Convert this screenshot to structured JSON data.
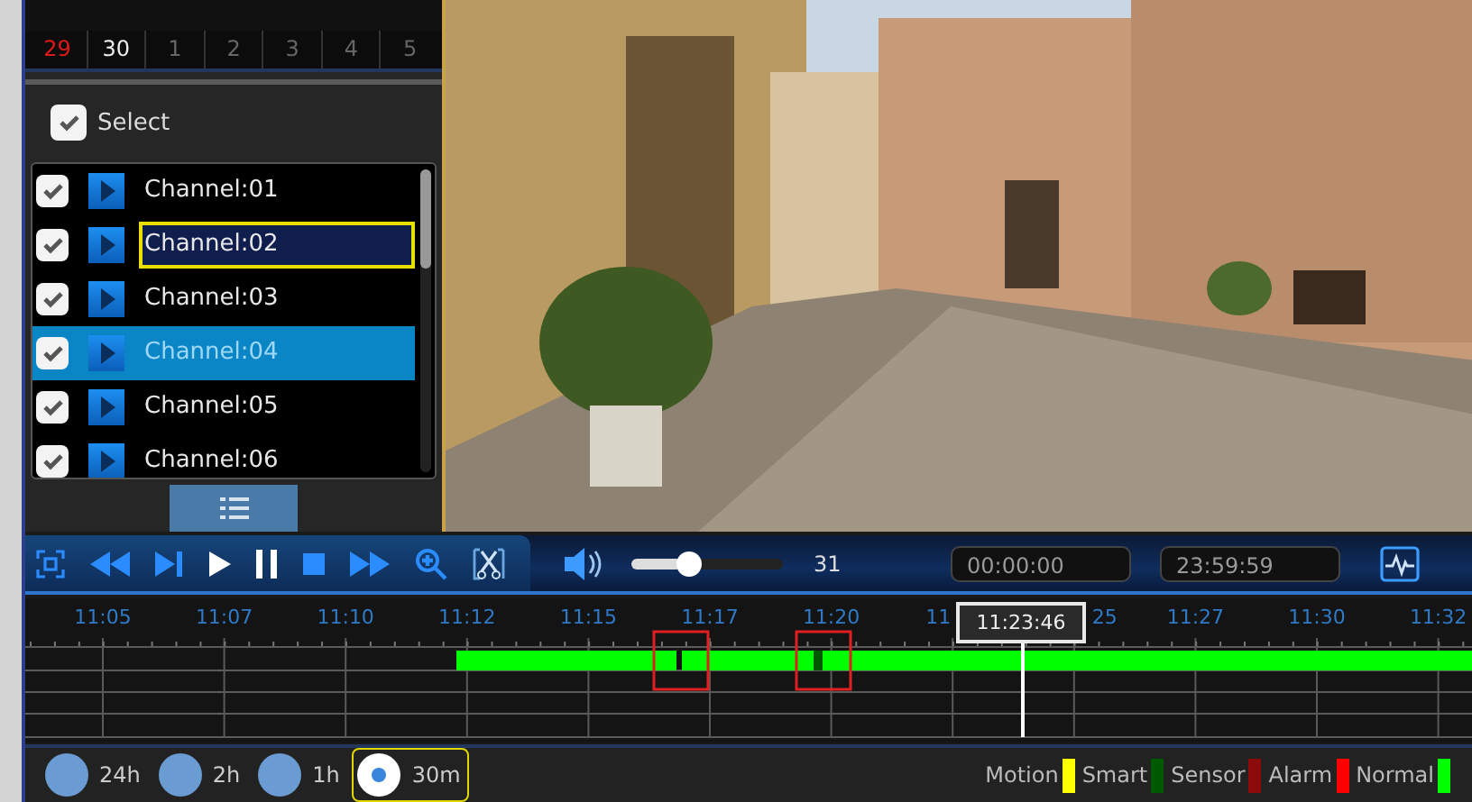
{
  "calendar": {
    "days": [
      {
        "text": "29",
        "kind": "weekend"
      },
      {
        "text": "30",
        "kind": "current"
      },
      {
        "text": "1",
        "kind": "other"
      },
      {
        "text": "2",
        "kind": "other"
      },
      {
        "text": "3",
        "kind": "other"
      },
      {
        "text": "4",
        "kind": "other"
      },
      {
        "text": "5",
        "kind": "other"
      }
    ]
  },
  "select_all": {
    "label": "Select",
    "checked": true
  },
  "channels": [
    {
      "name": "Channel:01",
      "checked": true,
      "selected": false,
      "focused": false
    },
    {
      "name": "Channel:02",
      "checked": true,
      "selected": false,
      "focused": true
    },
    {
      "name": "Channel:03",
      "checked": true,
      "selected": false,
      "focused": false
    },
    {
      "name": "Channel:04",
      "checked": true,
      "selected": true,
      "focused": false
    },
    {
      "name": "Channel:05",
      "checked": true,
      "selected": false,
      "focused": false
    },
    {
      "name": "Channel:06",
      "checked": true,
      "selected": false,
      "focused": false
    }
  ],
  "volume": {
    "level": 0.33,
    "reading": "31"
  },
  "start_time": "00:00:00",
  "end_time": "23:59:59",
  "timeline": {
    "labels": [
      {
        "text": "11:05"
      },
      {
        "text": "11:07"
      },
      {
        "text": "11:10"
      },
      {
        "text": "11:12"
      },
      {
        "text": "11:15"
      },
      {
        "text": "11:17"
      },
      {
        "text": "11:20"
      },
      {
        "text": "11",
        "cut_end": true
      },
      {
        "text": "25",
        "cut_start": true
      },
      {
        "text": "11:27"
      },
      {
        "text": "11:30"
      },
      {
        "text": "11:32"
      }
    ],
    "cursor_time": "11:23:46"
  },
  "scales": [
    {
      "label": "24h",
      "selected": false
    },
    {
      "label": "2h",
      "selected": false
    },
    {
      "label": "1h",
      "selected": false
    },
    {
      "label": "30m",
      "selected": true
    }
  ],
  "legend": [
    {
      "label": "Motion",
      "color": "#ffff00"
    },
    {
      "label": "Smart",
      "color": "#005a00"
    },
    {
      "label": "Sensor",
      "color": "#8b0a0a"
    },
    {
      "label": "Alarm",
      "color": "#ff0000"
    },
    {
      "label": "Normal",
      "color": "#00ff00"
    }
  ]
}
